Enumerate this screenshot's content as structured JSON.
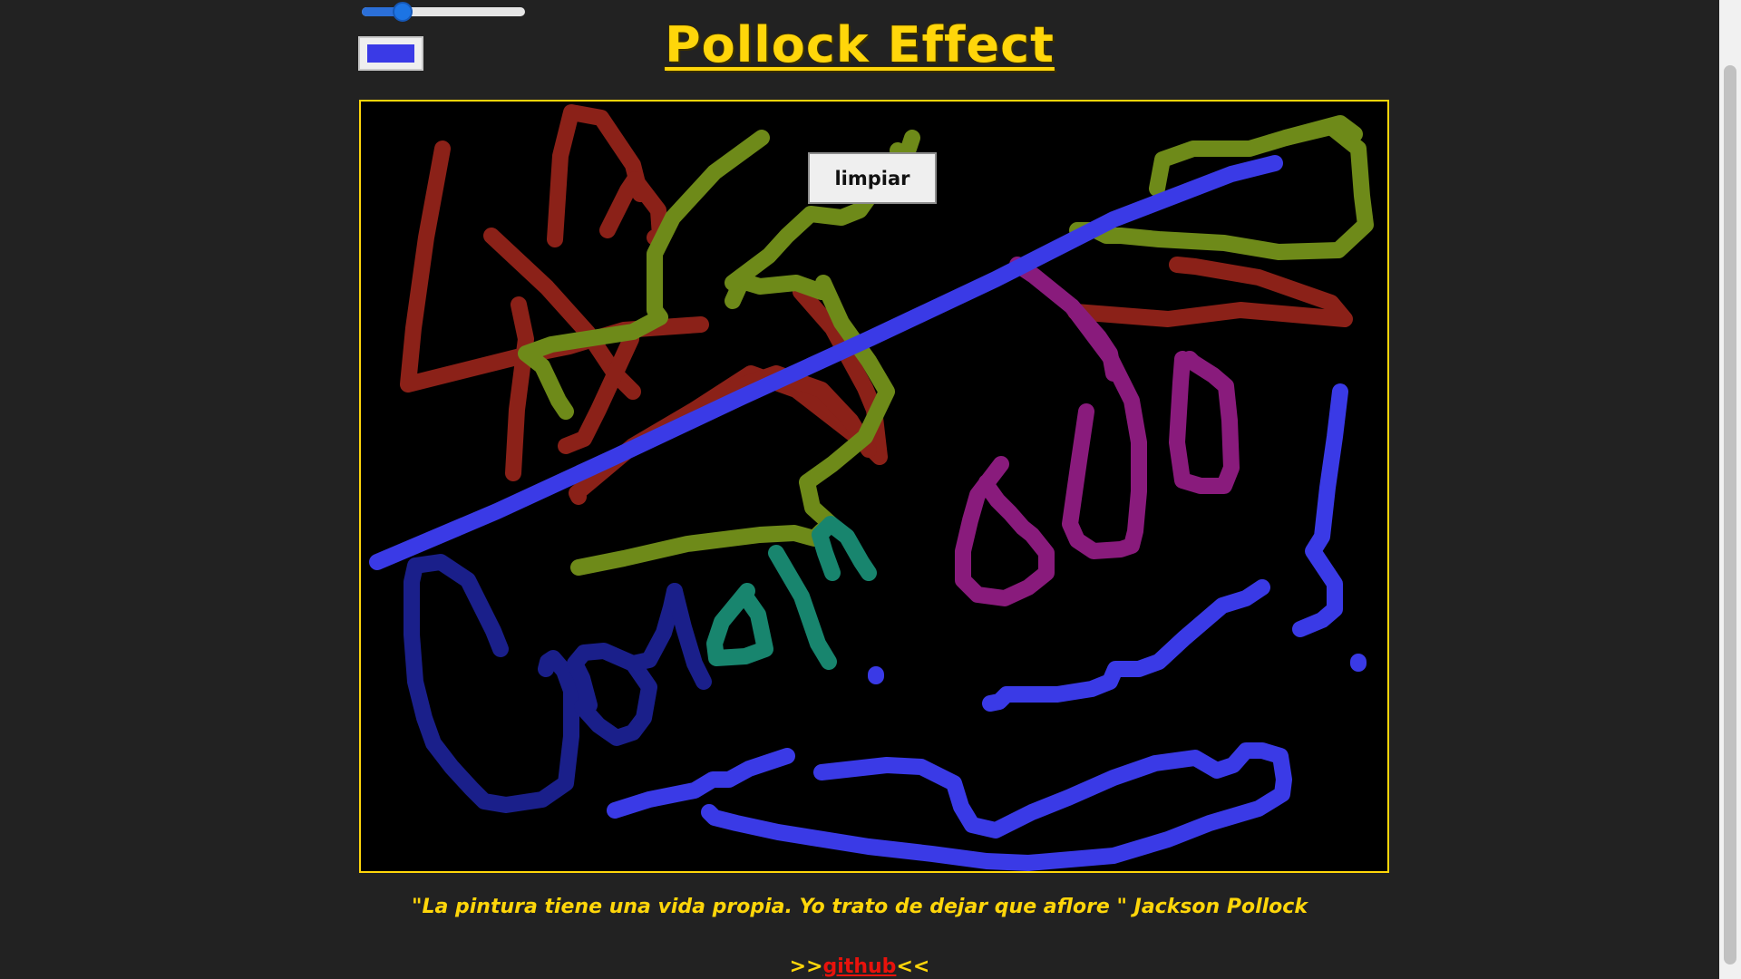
{
  "controls": {
    "brush_size_fraction": 0.22,
    "brush_color": "#3a3ae6"
  },
  "header": {
    "title": "Pollock Effect"
  },
  "canvas": {
    "clear_label": "limpiar",
    "background": "#000000",
    "border_color": "#ffd60a",
    "stroke_colors": [
      "#8b2118",
      "#6e8a19",
      "#3a3ae6",
      "#891b7c",
      "#1a1f8a",
      "#18856e"
    ]
  },
  "quote": {
    "text": "\"La pintura tiene una vida propia. Yo trato de dejar que aflore \" Jackson Pollock"
  },
  "footer": {
    "prefix": ">>",
    "link_label": "github",
    "suffix": "<<"
  }
}
